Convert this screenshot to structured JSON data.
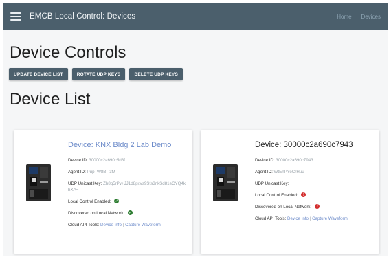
{
  "header": {
    "menu_icon": "hamburger-icon",
    "title": "EMCB Local Control: Devices",
    "nav": [
      "Home",
      "Devices"
    ]
  },
  "controls": {
    "heading": "Device Controls",
    "buttons": [
      "UPDATE DEVICE LIST",
      "ROTATE UDP KEYS",
      "DELETE UDP KEYS"
    ]
  },
  "device_list": {
    "heading": "Device List",
    "devices": [
      {
        "title": "Device: KNX Bldg 2 Lab Demo",
        "title_is_link": true,
        "device_id_label": "Device ID:",
        "device_id": "30000c2a690c5d8f",
        "agent_id_label": "Agent ID:",
        "agent_id": "Pup_W8B_i3M",
        "udp_label": "UDP Unicast Key:",
        "udp_key": "Zh8q5rPv+JJ1d8pxvs9Sfs3nkSd81eCYQ4khXA=",
        "local_control_label": "Local Control Enabled:",
        "local_control_status": "enabled",
        "discovered_label": "Discovered on Local Network:",
        "discovered_status": "yes",
        "cloud_label": "Cloud API Tools:",
        "cloud_link_1": "Device Info",
        "cloud_sep": "|",
        "cloud_link_2": "Capture Waveform"
      },
      {
        "title": "Device: 30000c2a690c7943",
        "title_is_link": false,
        "device_id_label": "Device ID:",
        "device_id": "30000c2a690c7943",
        "agent_id_label": "Agent ID:",
        "agent_id": "WtEnPYeCrHuu-_",
        "udp_label": "UDP Unicast Key:",
        "udp_key": "",
        "local_control_label": "Local Control Enabled:",
        "local_control_status": "disabled",
        "discovered_label": "Discovered on Local Network:",
        "discovered_status": "no",
        "cloud_label": "Cloud API Tools:",
        "cloud_link_1": "Device Info",
        "cloud_sep": "|",
        "cloud_link_2": "Capture Waveform"
      }
    ]
  },
  "colors": {
    "topbar": "#4b5f6c",
    "button": "#4b5f6c",
    "link": "#6b8ac9",
    "ok": "#2e7d32",
    "error": "#d32f2f"
  }
}
